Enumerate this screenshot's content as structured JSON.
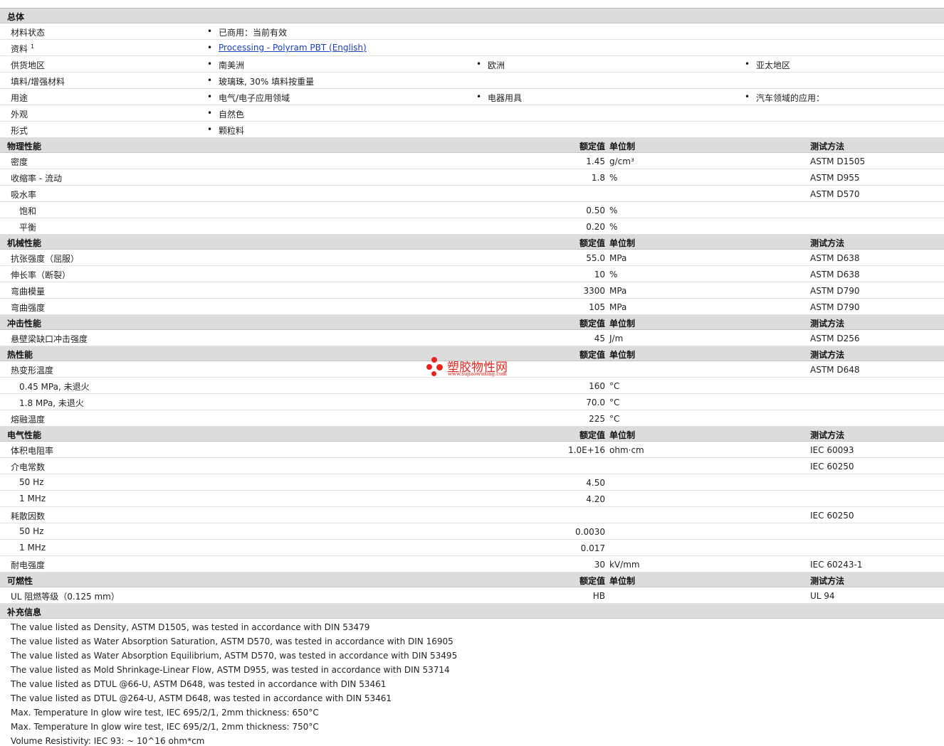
{
  "general": {
    "title": "总体",
    "rows": [
      {
        "label": "材料状态",
        "items": [
          "已商用：当前有效"
        ]
      },
      {
        "label": "资料",
        "sup": "1",
        "link": "Processing - Polyram PBT (English)"
      },
      {
        "label": "供货地区",
        "items": [
          "南美洲",
          "欧洲",
          "亚太地区"
        ]
      },
      {
        "label": "填料/增强材料",
        "items": [
          "玻璃珠, 30% 填料按重量"
        ]
      },
      {
        "label": "用途",
        "items": [
          "电气/电子应用领域",
          "电器用具",
          "汽车领域的应用："
        ]
      },
      {
        "label": "外观",
        "items": [
          "自然色"
        ]
      },
      {
        "label": "形式",
        "items": [
          "颗粒料"
        ]
      }
    ]
  },
  "headers": {
    "value": "额定值",
    "unit": "单位制",
    "test": "测试方法"
  },
  "physical": {
    "title": "物理性能",
    "rows": [
      {
        "label": "密度",
        "value": "1.45",
        "unit": "g/cm³",
        "test": "ASTM D1505"
      },
      {
        "label": "收缩率 - 流动",
        "value": "1.8",
        "unit": "%",
        "test": "ASTM D955"
      },
      {
        "label": "吸水率",
        "value": "",
        "unit": "",
        "test": "ASTM D570"
      },
      {
        "label": "饱和",
        "value": "0.50",
        "unit": "%",
        "test": ""
      },
      {
        "label": "平衡",
        "value": "0.20",
        "unit": "%",
        "test": ""
      }
    ]
  },
  "mechanical": {
    "title": "机械性能",
    "rows": [
      {
        "label": "抗张强度（屈服）",
        "value": "55.0",
        "unit": "MPa",
        "test": "ASTM D638"
      },
      {
        "label": "伸长率（断裂）",
        "value": "10",
        "unit": "%",
        "test": "ASTM D638"
      },
      {
        "label": "弯曲模量",
        "value": "3300",
        "unit": "MPa",
        "test": "ASTM D790"
      },
      {
        "label": "弯曲强度",
        "value": "105",
        "unit": "MPa",
        "test": "ASTM D790"
      }
    ]
  },
  "impact": {
    "title": "冲击性能",
    "rows": [
      {
        "label": "悬壁梁缺口冲击强度",
        "value": "45",
        "unit": "J/m",
        "test": "ASTM D256"
      }
    ]
  },
  "thermal": {
    "title": "热性能",
    "rows": [
      {
        "label": "热变形温度",
        "value": "",
        "unit": "",
        "test": "ASTM D648"
      },
      {
        "label": "0.45 MPa, 未退火",
        "value": "160",
        "unit": "°C",
        "test": ""
      },
      {
        "label": "1.8 MPa, 未退火",
        "value": "70.0",
        "unit": "°C",
        "test": ""
      },
      {
        "label": "熔融温度",
        "value": "225",
        "unit": "°C",
        "test": ""
      }
    ]
  },
  "electrical": {
    "title": "电气性能",
    "rows": [
      {
        "label": "体积电阻率",
        "value": "1.0E+16",
        "unit": "ohm·cm",
        "test": "IEC 60093"
      },
      {
        "label": "介电常数",
        "value": "",
        "unit": "",
        "test": "IEC 60250"
      },
      {
        "label": "50 Hz",
        "value": "4.50",
        "unit": "",
        "test": ""
      },
      {
        "label": "1 MHz",
        "value": "4.20",
        "unit": "",
        "test": ""
      },
      {
        "label": "耗散因数",
        "value": "",
        "unit": "",
        "test": "IEC 60250"
      },
      {
        "label": "50 Hz",
        "value": "0.0030",
        "unit": "",
        "test": ""
      },
      {
        "label": "1 MHz",
        "value": "0.017",
        "unit": "",
        "test": ""
      },
      {
        "label": "耐电强度",
        "value": "30",
        "unit": "kV/mm",
        "test": "IEC 60243-1"
      }
    ]
  },
  "flammability": {
    "title": "可燃性",
    "rows": [
      {
        "label": "UL 阻燃等级（0.125 mm）",
        "value": "HB",
        "unit": "",
        "test": "UL 94"
      }
    ]
  },
  "supplement": {
    "title": "补充信息",
    "notes": [
      "The value listed as Density, ASTM D1505, was tested in accordance with DIN 53479",
      "The value listed as Water Absorption Saturation, ASTM D570, was tested in accordance with DIN 16905",
      "The value listed as Water Absorption Equilibrium, ASTM D570, was tested in accordance with DIN 53495",
      "The value listed as Mold Shrinkage-Linear Flow, ASTM D955, was tested in accordance with DIN 53714",
      "The value listed as DTUL @66-U, ASTM D648, was tested in accordance with DIN 53461",
      "The value listed as DTUL @264-U, ASTM D648, was tested in accordance with DIN 53461",
      "Max. Temperature In glow wire test, IEC 695/2/1, 2mm thickness: 650°C",
      "Max. Temperature In glow wire test, IEC 695/2/1, 2mm thickness: 750°C",
      "Volume Resistivity: IEC 93: ~ 10^16 ohm*cm"
    ]
  },
  "watermark": {
    "title": "塑胶物性网",
    "url": "www.sujiaowuxing.com",
    "color": "#e8251d"
  }
}
